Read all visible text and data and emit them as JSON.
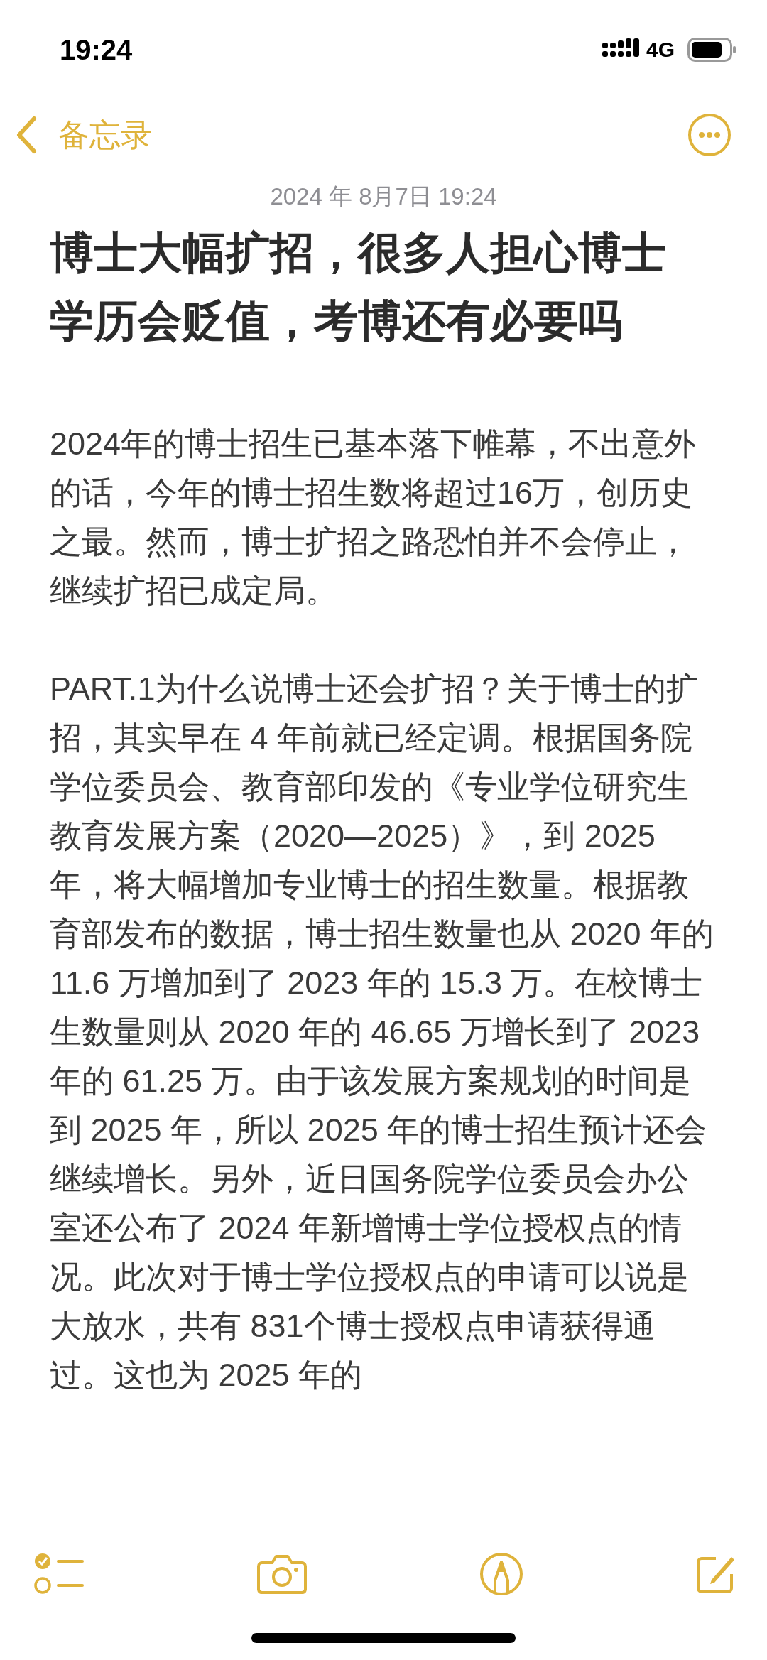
{
  "status_bar": {
    "time": "19:24",
    "network": "4G"
  },
  "nav": {
    "back_label": "备忘录"
  },
  "note": {
    "date": "2024 年 8月7日 19:24",
    "title": "博士大幅扩招，很多人担心博士学历会贬值，考博还有必要吗",
    "paragraphs": [
      "2024年的博士招生已基本落下帷幕，不出意外的话，今年的博士招生数将超过16万，创历史之最。然而，博士扩招之路恐怕并不会停止，继续扩招已成定局。",
      "PART.1为什么说博士还会扩招？关于博士的扩招，其实早在 4 年前就已经定调。根据国务院学位委员会、教育部印发的《专业学位研究生教育发展方案（2020—2025）》，到 2025 年，将大幅增加专业博士的招生数量。根据教育部发布的数据，博士招生数量也从 2020 年的 11.6 万增加到了 2023 年的 15.3 万。在校博士生数量则从 2020 年的 46.65 万增长到了 2023 年的 61.25 万。由于该发展方案规划的时间是到 2025 年，所以 2025 年的博士招生预计还会继续增长。另外，近日国务院学位委员会办公室还公布了 2024 年新增博士学位授权点的情况。此次对于博士学位授权点的申请可以说是大放水，共有 831个博士授权点申请获得通过。这也为 2025 年的"
    ]
  }
}
